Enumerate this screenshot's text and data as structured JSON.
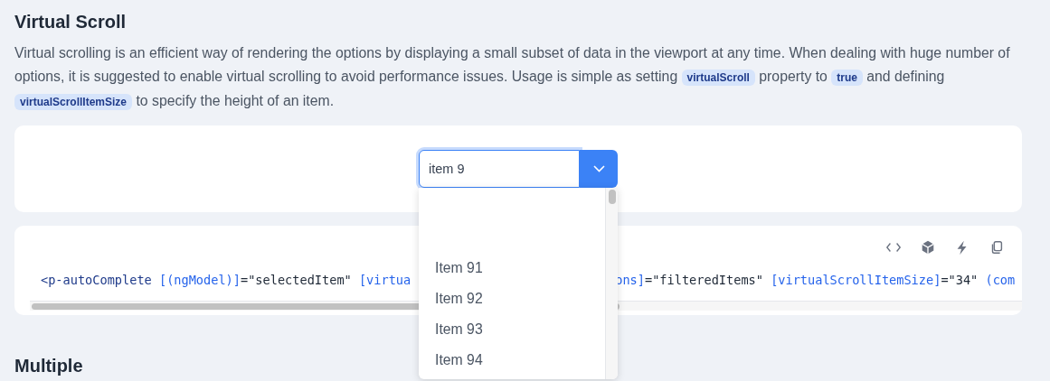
{
  "section_title": "Virtual Scroll",
  "description": [
    {
      "kind": "text",
      "text": "Virtual scrolling is an efficient way of rendering the options by displaying a small subset of data in the viewport at any time. When dealing with huge number of options, it is suggested to enable virtual scrolling to avoid performance issues. Usage is simple as setting "
    },
    {
      "kind": "code",
      "text": "virtualScroll"
    },
    {
      "kind": "text",
      "text": " property to "
    },
    {
      "kind": "code",
      "text": "true"
    },
    {
      "kind": "text",
      "text": " and defining "
    },
    {
      "kind": "code",
      "text": "virtualScrollItemSize"
    },
    {
      "kind": "text",
      "text": " to specify the height of an item."
    }
  ],
  "autocomplete": {
    "value": "item 9",
    "expanded": true,
    "items": [
      "Item 91",
      "Item 92",
      "Item 93",
      "Item 94"
    ]
  },
  "code_left": [
    {
      "kind": "tag",
      "text": "<p-autoComplete "
    },
    {
      "kind": "attr",
      "text": "[(ngModel)]"
    },
    {
      "kind": "plain",
      "text": "=\"selectedItem\" "
    },
    {
      "kind": "attr",
      "text": "[virtua"
    }
  ],
  "code_right": [
    {
      "kind": "attr",
      "text": "ons]"
    },
    {
      "kind": "plain",
      "text": "=\"filteredItems\" "
    },
    {
      "kind": "attr",
      "text": "[virtualScrollItemSize]"
    },
    {
      "kind": "plain",
      "text": "=\"34\" "
    },
    {
      "kind": "attr",
      "text": "(com"
    }
  ],
  "next_section_title": "Multiple"
}
